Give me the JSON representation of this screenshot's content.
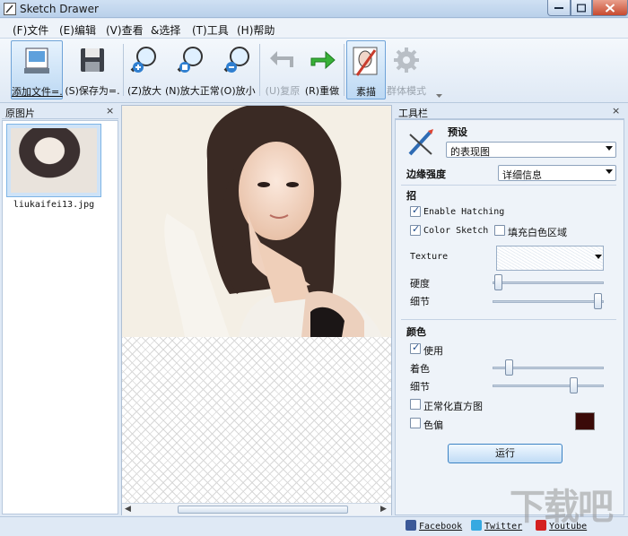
{
  "window": {
    "title": "Sketch Drawer"
  },
  "menu": [
    "(F)文件",
    "(E)编辑",
    "(V)查看",
    "&选择",
    "(T)工具",
    "(H)帮助"
  ],
  "toolbar": {
    "add_file": "添加文件=.",
    "save_as": "(S)保存为=.",
    "zoom_in": "(Z)放大",
    "zoom_normal": "(N)放大正常",
    "zoom_out": "(O)放小",
    "undo": "(U)复原",
    "redo": "(R)重做",
    "sketch": "素描",
    "batch_mode": "群体模式"
  },
  "left_panel": {
    "title": "原图片",
    "close": "×",
    "files": [
      {
        "name": "liukaifei13.jpg"
      }
    ]
  },
  "right_panel": {
    "title": "工具栏",
    "close": "×",
    "preset_label": "预设",
    "preset_value": "的表现图",
    "edge_label": "边缘强度",
    "edge_value": "详细信息",
    "section_stroke": "招",
    "enable_hatching": {
      "label": "Enable Hatching",
      "checked": true
    },
    "color_sketch": {
      "label": "Color Sketch",
      "checked": true
    },
    "fill_white": {
      "label": "填充白色区域",
      "checked": false
    },
    "texture_label": "Texture",
    "hardness_label": "硬度",
    "hardness_value": 0.02,
    "detail_label": "细节",
    "detail_value": 0.98,
    "section_color": "颜色",
    "use_label": "使用",
    "use_checked": true,
    "tint_label": "着色",
    "tint_value": 0.12,
    "color_detail_label": "细节",
    "color_detail_value": 0.75,
    "normalize_label": "正常化直方图",
    "normalize_checked": false,
    "colorcast_label": "色偏",
    "colorcast_checked": false,
    "swatch_color": "#3a0a08",
    "run_label": "运行"
  },
  "status": {
    "facebook": "Facebook",
    "twitter": "Twitter",
    "youtube": "Youtube"
  },
  "watermark": "下载吧"
}
